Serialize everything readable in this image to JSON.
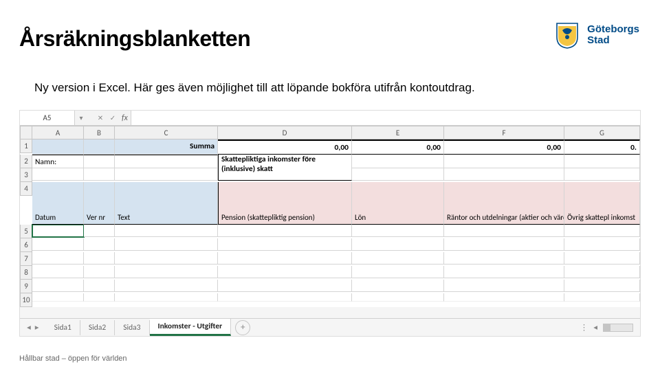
{
  "slide": {
    "title": "Årsräkningsblanketten",
    "subtitle": "Ny version i Excel. Här ges även möjlighet till att löpande bokföra utifrån kontoutdrag.",
    "footer": "Hållbar stad – öppen för världen",
    "logo_line1": "Göteborgs",
    "logo_line2": "Stad"
  },
  "excel": {
    "namebox": "A5",
    "fx_label": "fx",
    "columns": [
      "A",
      "B",
      "C",
      "D",
      "E",
      "F",
      "G"
    ],
    "row_nums": [
      "1",
      "2",
      "3",
      "4",
      "5",
      "6",
      "7",
      "8",
      "9",
      "10"
    ],
    "row1": {
      "summa_label": "Summa",
      "d": "0,00",
      "e": "0,00",
      "f": "0,00",
      "g": "0."
    },
    "row2": {
      "namn_label": "Namn:",
      "d_header": "Skattepliktiga inkomster före (inklusive) skatt"
    },
    "row4": {
      "a": "Datum",
      "b": "Ver nr",
      "c": "Text",
      "d": "Pension (skattepliktig pension)",
      "e": "Lön",
      "f": "Räntor och utdelningar (aktier och värdepapper)",
      "g": "Övrig skattepl inkomst"
    },
    "tabs": {
      "items": [
        "Sida1",
        "Sida2",
        "Sida3",
        "Inkomster - Utgifter"
      ],
      "active_index": 3
    }
  }
}
